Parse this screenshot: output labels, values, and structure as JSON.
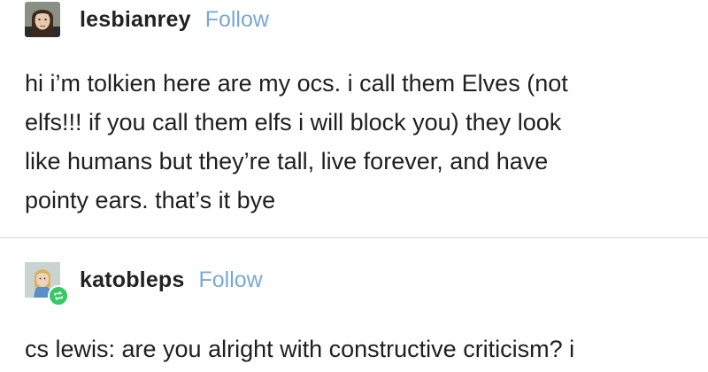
{
  "posts": [
    {
      "username": "lesbianrey",
      "follow_label": "Follow",
      "avatar_icon": "user-avatar-photo",
      "body_lines": [
        "hi i’m tolkien here are my ocs. i call them Elves (not",
        "elfs!!! if you call them elfs i will block you) they look",
        "like humans but they’re tall, live forever, and have",
        "pointy ears. that’s it bye"
      ]
    },
    {
      "username": "katobleps",
      "follow_label": "Follow",
      "avatar_icon": "user-avatar-character",
      "badge_icon": "reblog-icon",
      "body_lines": [
        "cs lewis: are you alright with constructive criticism? i"
      ]
    }
  ],
  "colors": {
    "follow": "#78a9d6",
    "reblog_badge": "#37c864",
    "divider": "#d6d6d6"
  }
}
